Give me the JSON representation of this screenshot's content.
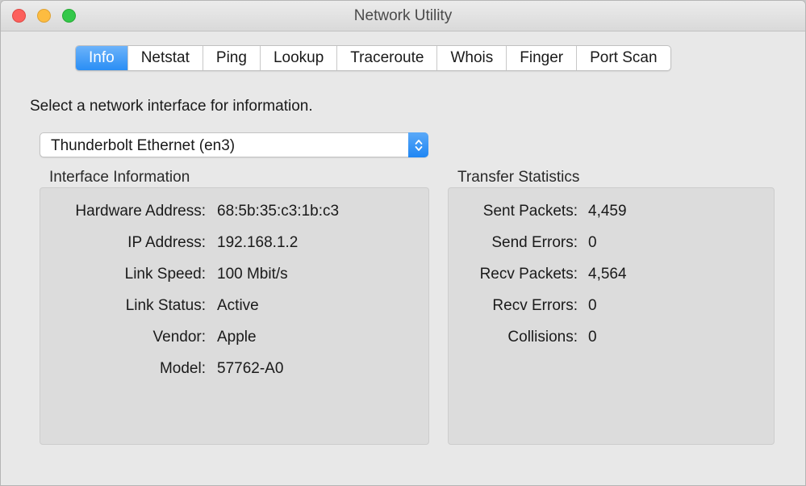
{
  "window": {
    "title": "Network Utility"
  },
  "tabs": [
    {
      "label": "Info",
      "active": true
    },
    {
      "label": "Netstat",
      "active": false
    },
    {
      "label": "Ping",
      "active": false
    },
    {
      "label": "Lookup",
      "active": false
    },
    {
      "label": "Traceroute",
      "active": false
    },
    {
      "label": "Whois",
      "active": false
    },
    {
      "label": "Finger",
      "active": false
    },
    {
      "label": "Port Scan",
      "active": false
    }
  ],
  "prompt": "Select a network interface for information.",
  "interface_select": {
    "value": "Thunderbolt Ethernet (en3)"
  },
  "interface_info": {
    "label": "Interface Information",
    "rows": [
      {
        "key": "Hardware Address:",
        "value": "68:5b:35:c3:1b:c3"
      },
      {
        "key": "IP Address:",
        "value": "192.168.1.2"
      },
      {
        "key": "Link Speed:",
        "value": "100 Mbit/s"
      },
      {
        "key": "Link Status:",
        "value": "Active"
      },
      {
        "key": "Vendor:",
        "value": "Apple"
      },
      {
        "key": "Model:",
        "value": "57762-A0"
      }
    ]
  },
  "transfer_stats": {
    "label": "Transfer Statistics",
    "rows": [
      {
        "key": "Sent Packets:",
        "value": "4,459"
      },
      {
        "key": "Send Errors:",
        "value": "0"
      },
      {
        "key": "Recv Packets:",
        "value": "4,564"
      },
      {
        "key": "Recv Errors:",
        "value": "0"
      },
      {
        "key": "Collisions:",
        "value": "0"
      }
    ]
  },
  "colors": {
    "accent": "#2a8ef5",
    "window_bg": "#e8e8e8",
    "box_bg": "#dcdcdc"
  }
}
